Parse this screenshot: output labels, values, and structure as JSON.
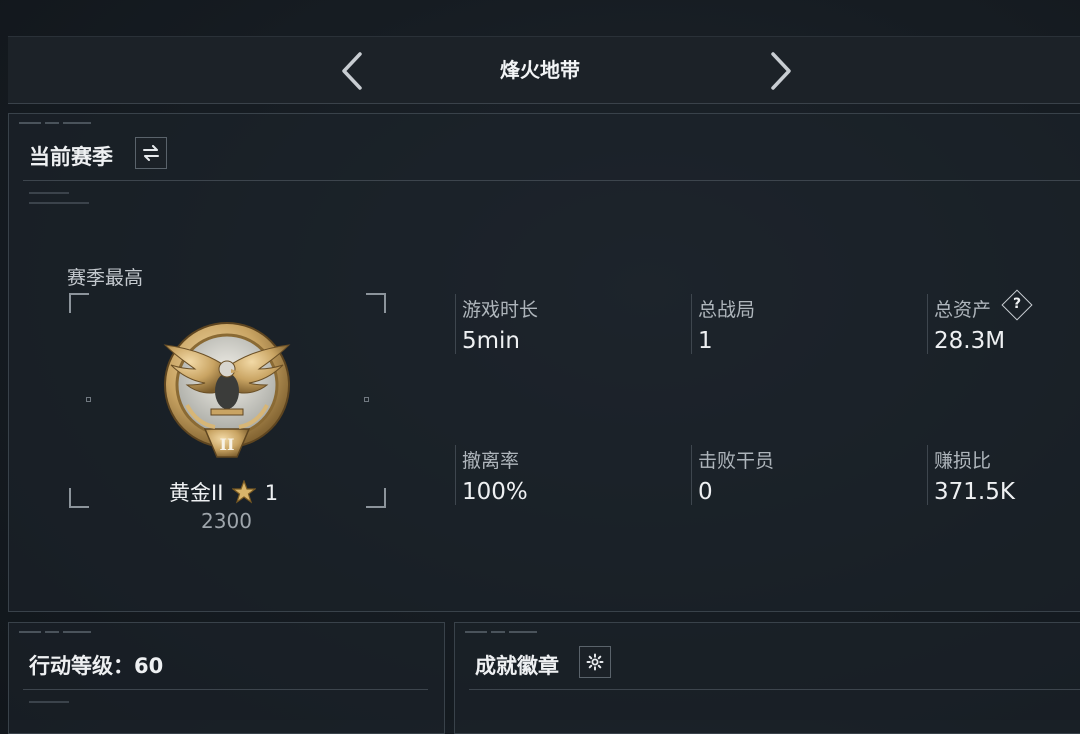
{
  "header": {
    "title": "烽火地带"
  },
  "season_panel": {
    "title": "当前赛季",
    "season_best_label": "赛季最高",
    "rank": {
      "name": "黄金II",
      "stars": "1",
      "score": "2300"
    },
    "stats": [
      {
        "label": "游戏时长",
        "value": "5min"
      },
      {
        "label": "总战局",
        "value": "1"
      },
      {
        "label": "总资产",
        "value": "28.3M",
        "help": "?"
      },
      {
        "label": "撤离率",
        "value": "100%"
      },
      {
        "label": "击败干员",
        "value": "0"
      },
      {
        "label": "赚损比",
        "value": "371.5K"
      }
    ]
  },
  "level_panel": {
    "title": "行动等级：60"
  },
  "badge_panel": {
    "title": "成就徽章"
  },
  "colors": {
    "accent_gold": "#c9a463",
    "text": "#eef0f2",
    "muted": "#aeb5bb",
    "border": "#39424a"
  },
  "icons": {
    "prev": "chevron-left-icon",
    "next": "chevron-right-icon",
    "switch": "swap-arrows-icon",
    "settings": "gear-icon",
    "rank": "gold-eagle-medal-icon",
    "star": "star-icon",
    "help": "question-icon"
  }
}
